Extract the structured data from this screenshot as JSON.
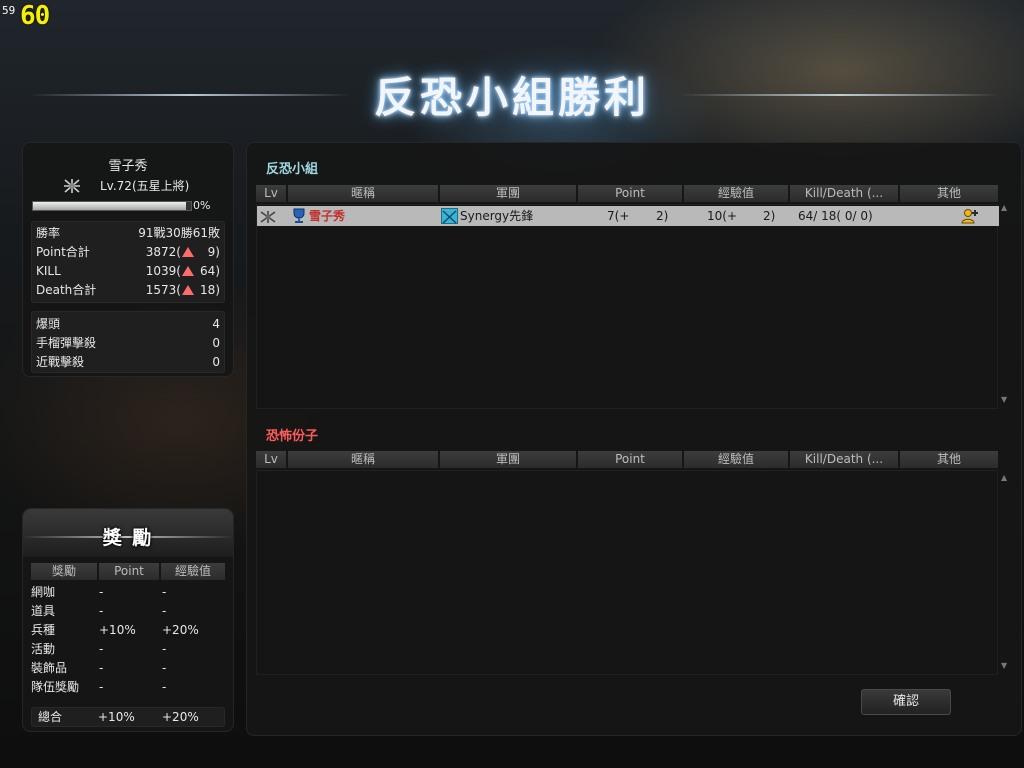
{
  "fps": {
    "small": "59",
    "big": "60"
  },
  "title": "反恐小組勝利",
  "player": {
    "name": "雪子秀",
    "level": "Lv.72(五星上將)",
    "exp_percent": 97,
    "exp_label": "0%",
    "stats": [
      {
        "label": "勝率",
        "value": "91戰30勝61敗",
        "delta": ""
      },
      {
        "label": "Point合計",
        "value": "3872(",
        "delta": "9)"
      },
      {
        "label": "KILL",
        "value": "1039(",
        "delta": "64)"
      },
      {
        "label": "Death合計",
        "value": "1573(",
        "delta": "18)"
      }
    ],
    "kills": [
      {
        "label": "爆頭",
        "value": "4"
      },
      {
        "label": "手榴彈擊殺",
        "value": "0"
      },
      {
        "label": "近戰擊殺",
        "value": "0"
      }
    ]
  },
  "reward": {
    "title": "獎 勵",
    "headers": [
      "獎勵",
      "Point",
      "經驗值"
    ],
    "rows": [
      {
        "label": "網咖",
        "point": "-",
        "exp": "-"
      },
      {
        "label": "道具",
        "point": "-",
        "exp": "-"
      },
      {
        "label": "兵種",
        "point": "+10%",
        "exp": "+20%"
      },
      {
        "label": "活動",
        "point": "-",
        "exp": "-"
      },
      {
        "label": "裝飾品",
        "point": "-",
        "exp": "-"
      },
      {
        "label": "隊伍獎勵",
        "point": "-",
        "exp": "-"
      }
    ],
    "total": {
      "label": "總合",
      "point": "+10%",
      "exp": "+20%"
    }
  },
  "teams": {
    "headers": [
      "Lv",
      "暱稱",
      "軍團",
      "Point",
      "經驗值",
      "Kill/Death (...",
      "其他"
    ],
    "ct": {
      "name": "反恐小組",
      "rows": [
        {
          "nickname": "雪子秀",
          "clan": "Synergy先鋒",
          "point": "7(+",
          "point_delta": "2)",
          "exp": "10(+",
          "exp_delta": "2)",
          "kd": "64/ 18( 0/ 0)"
        }
      ]
    },
    "t": {
      "name": "恐怖份子",
      "rows": []
    }
  },
  "colors": {
    "ct_team": "#9fd6e0",
    "t_team": "#ff5a5a",
    "row_highlight": "#b9b9b9",
    "nickname": "#c0302c"
  },
  "confirm_label": "確認"
}
